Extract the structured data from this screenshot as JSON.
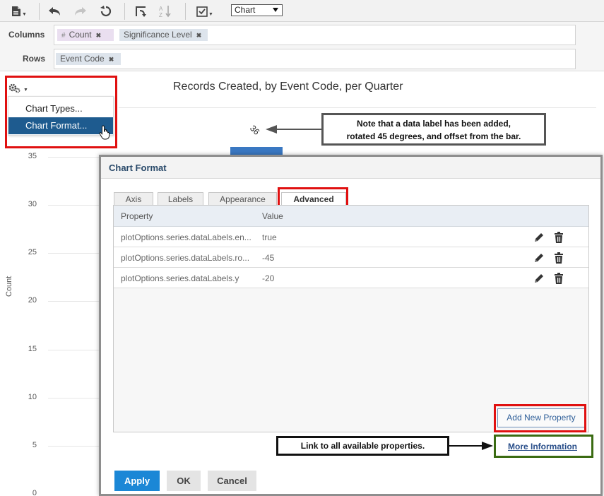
{
  "toolbar": {
    "view_select": "Chart"
  },
  "shelves": {
    "columns_label": "Columns",
    "rows_label": "Rows",
    "columns": [
      {
        "prefix": "#",
        "label": "Count"
      },
      {
        "label": "Significance Level"
      }
    ],
    "rows": [
      {
        "label": "Event Code"
      }
    ]
  },
  "chart": {
    "title": "Records Created, by Event Code, per Quarter",
    "ylabel": "Count",
    "yticks": [
      "35",
      "30",
      "25",
      "20",
      "15",
      "10",
      "5",
      "0"
    ],
    "data_label": "36"
  },
  "gear_menu": {
    "items": [
      "Chart Types...",
      "Chart Format..."
    ]
  },
  "annotations": {
    "note_line1": "Note that a data label has been added,",
    "note_line2": "rotated 45 degrees, and offset from the bar.",
    "link_note": "Link to all available properties."
  },
  "dialog": {
    "title": "Chart Format",
    "tabs": [
      "Axis",
      "Labels",
      "Appearance",
      "Advanced"
    ],
    "active_tab": "Advanced",
    "columns": {
      "property": "Property",
      "value": "Value"
    },
    "rows": [
      {
        "property": "plotOptions.series.dataLabels.en...",
        "value": "true"
      },
      {
        "property": "plotOptions.series.dataLabels.ro...",
        "value": "-45"
      },
      {
        "property": "plotOptions.series.dataLabels.y",
        "value": "-20"
      }
    ],
    "add_button": "Add New Property",
    "more_link": "More Information",
    "buttons": {
      "apply": "Apply",
      "ok": "OK",
      "cancel": "Cancel"
    }
  },
  "colors": {
    "primary_button": "#1b87d6",
    "highlight_red": "#e01010",
    "highlight_green": "#3a6b12",
    "menu_selected": "#1e5b8f",
    "bar": "#3a78c2"
  }
}
